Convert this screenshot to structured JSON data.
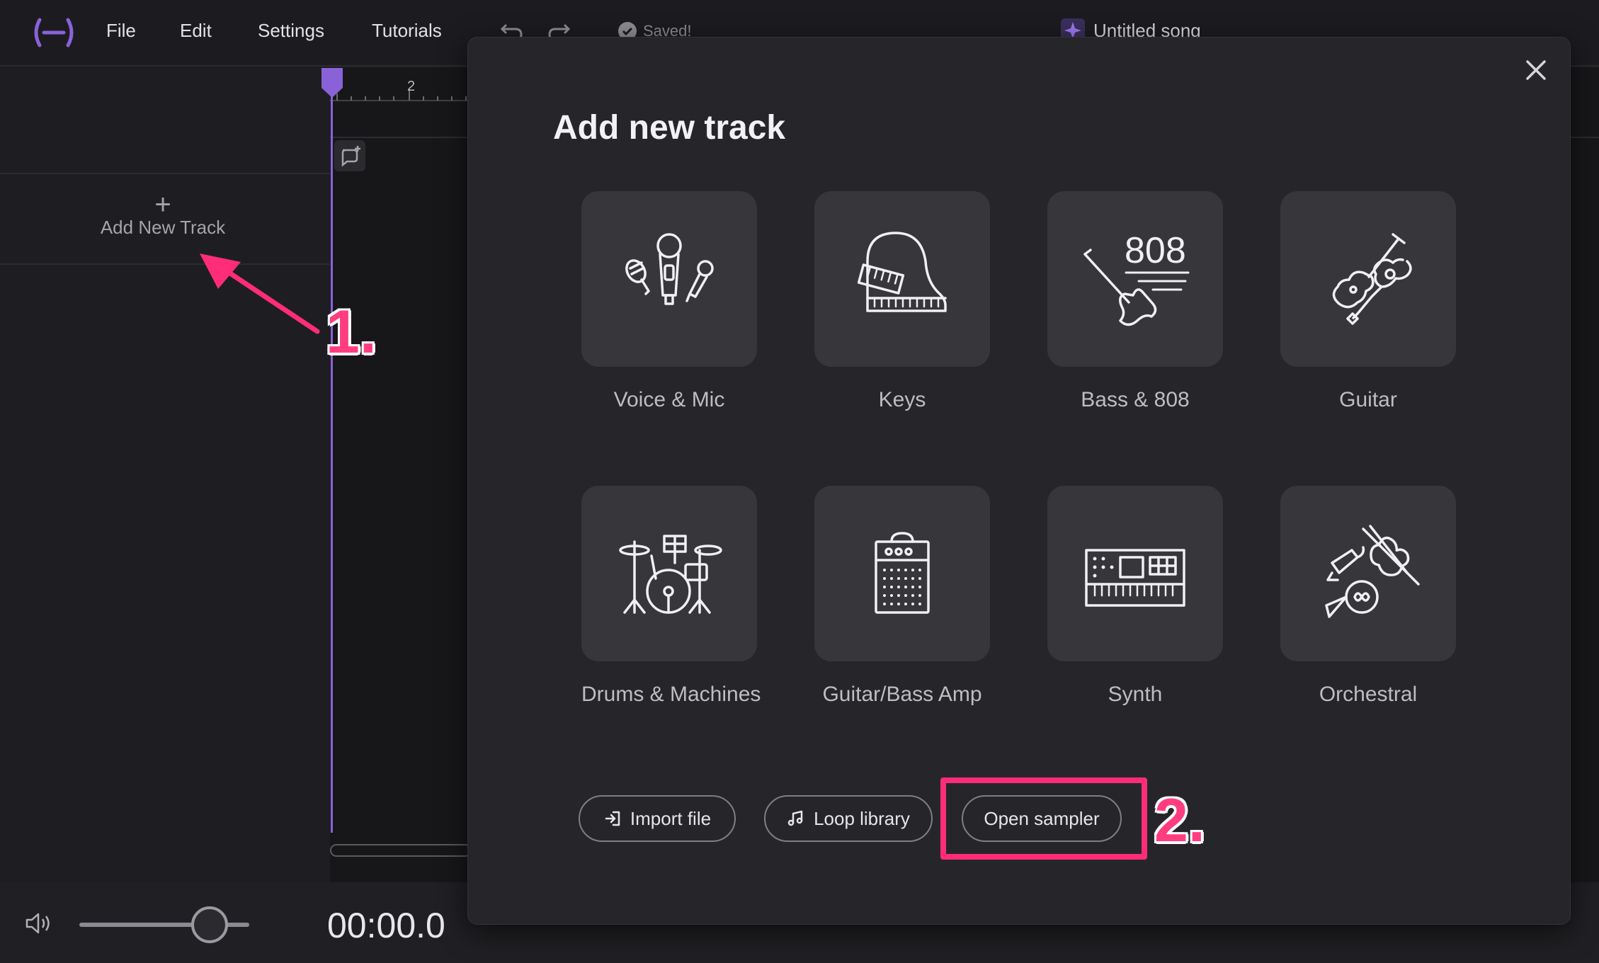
{
  "menu": {
    "file": "File",
    "edit": "Edit",
    "settings": "Settings",
    "tutorials": "Tutorials"
  },
  "status": {
    "saved": "Saved!"
  },
  "song": {
    "title": "Untitled song"
  },
  "ruler": {
    "bar_label": "2"
  },
  "sidebar": {
    "add_track_label": "Add New Track"
  },
  "transport": {
    "time": "00:00.0"
  },
  "annotations": {
    "step1": "1.",
    "step2": "2.",
    "color": "#ff3d7f"
  },
  "modal": {
    "title": "Add new track",
    "tiles": [
      {
        "label": "Voice & Mic",
        "icon": "microphones-icon"
      },
      {
        "label": "Keys",
        "icon": "piano-icon"
      },
      {
        "label": "Bass & 808",
        "icon": "bass-808-icon"
      },
      {
        "label": "Guitar",
        "icon": "guitars-icon"
      },
      {
        "label": "Drums & Machines",
        "icon": "drum-kit-icon"
      },
      {
        "label": "Guitar/Bass Amp",
        "icon": "amplifier-icon"
      },
      {
        "label": "Synth",
        "icon": "synthesizer-icon"
      },
      {
        "label": "Orchestral",
        "icon": "orchestral-instruments-icon"
      }
    ],
    "actions": {
      "import": "Import file",
      "loops": "Loop library",
      "sampler": "Open sampler"
    },
    "text_808": "808"
  },
  "colors": {
    "accent": "#8a62d8",
    "annotation": "#ff2d77",
    "record": "#e8245c"
  }
}
